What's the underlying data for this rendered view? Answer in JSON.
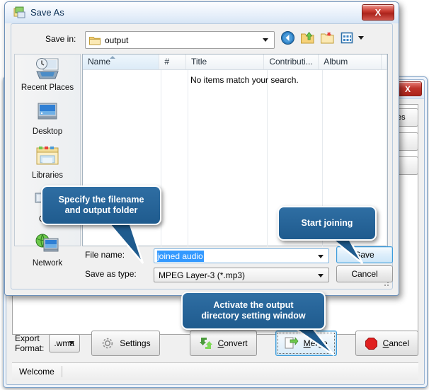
{
  "main_window": {
    "close_label": "X",
    "side_buttons": [
      {
        "label": "...les"
      },
      {
        "label": ""
      },
      {
        "label": ""
      }
    ],
    "toolbar": {
      "export_format_label": "Export Format:",
      "export_format_value": ".wma",
      "settings_label": "Settings",
      "convert_label": "Convert",
      "convert_accel": "C",
      "merge_label": "Merge",
      "merge_accel": "M",
      "cancel_label": "Cancel",
      "cancel_accel": "C"
    },
    "status_bar": {
      "message": "Welcome"
    }
  },
  "dialog": {
    "title": "Save As",
    "close_label": "X",
    "save_in_label": "Save in:",
    "save_in_value": "output",
    "nav_icons": [
      {
        "name": "back-icon"
      },
      {
        "name": "up-folder-icon"
      },
      {
        "name": "new-folder-icon"
      },
      {
        "name": "views-icon"
      }
    ],
    "places": [
      {
        "label": "Recent Places",
        "icon": "recent-places-icon"
      },
      {
        "label": "Desktop",
        "icon": "desktop-icon"
      },
      {
        "label": "Libraries",
        "icon": "libraries-icon"
      },
      {
        "label": "Com",
        "icon": "computer-icon"
      },
      {
        "label": "Network",
        "icon": "network-icon"
      }
    ],
    "file_list": {
      "columns": [
        "Name",
        "#",
        "Title",
        "Contributi...",
        "Album",
        ""
      ],
      "sorted_column": "Name",
      "empty_message": "No items match your search.",
      "rows": []
    },
    "file_name_label": "File name:",
    "file_name_value": "joined audio",
    "save_as_type_label": "Save as type:",
    "save_as_type_value": "MPEG Layer-3  (*.mp3)",
    "save_button": "Save",
    "cancel_button": "Cancel"
  },
  "callouts": [
    {
      "text": "Specify the filename\nand output folder",
      "line1": "Specify the filename",
      "line2": "and output folder"
    },
    {
      "text": "Start joining",
      "line1": "Start joining",
      "line2": ""
    },
    {
      "text": "Activate the output\ndirectory setting window",
      "line1": "Activate the output",
      "line2": "directory setting window"
    }
  ],
  "colors": {
    "callout_bg": "#2a679a",
    "accent_blue": "#3c9bdc",
    "selection_blue": "#3399ff",
    "close_red": "#c0352c"
  }
}
